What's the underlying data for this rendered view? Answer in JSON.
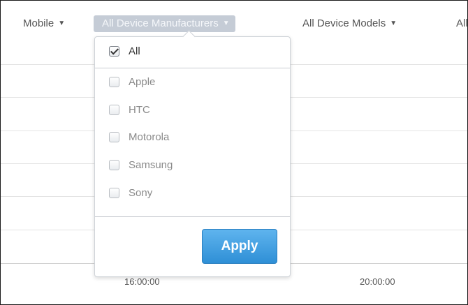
{
  "filters": {
    "platform": "Mobile",
    "manufacturers": "All Device Manufacturers",
    "models": "All Device Models",
    "overflow": "All"
  },
  "dropdown": {
    "all_label": "All",
    "all_checked": true,
    "options": [
      {
        "label": "Apple",
        "checked": false
      },
      {
        "label": "HTC",
        "checked": false
      },
      {
        "label": "Motorola",
        "checked": false
      },
      {
        "label": "Samsung",
        "checked": false
      },
      {
        "label": "Sony",
        "checked": false
      }
    ],
    "apply_label": "Apply"
  },
  "chart": {
    "x_ticks": [
      "16:00:00",
      "20:00:00"
    ]
  },
  "colors": {
    "selected_filter_bg": "#c5ccd6",
    "apply_button": "#3a9be0"
  }
}
